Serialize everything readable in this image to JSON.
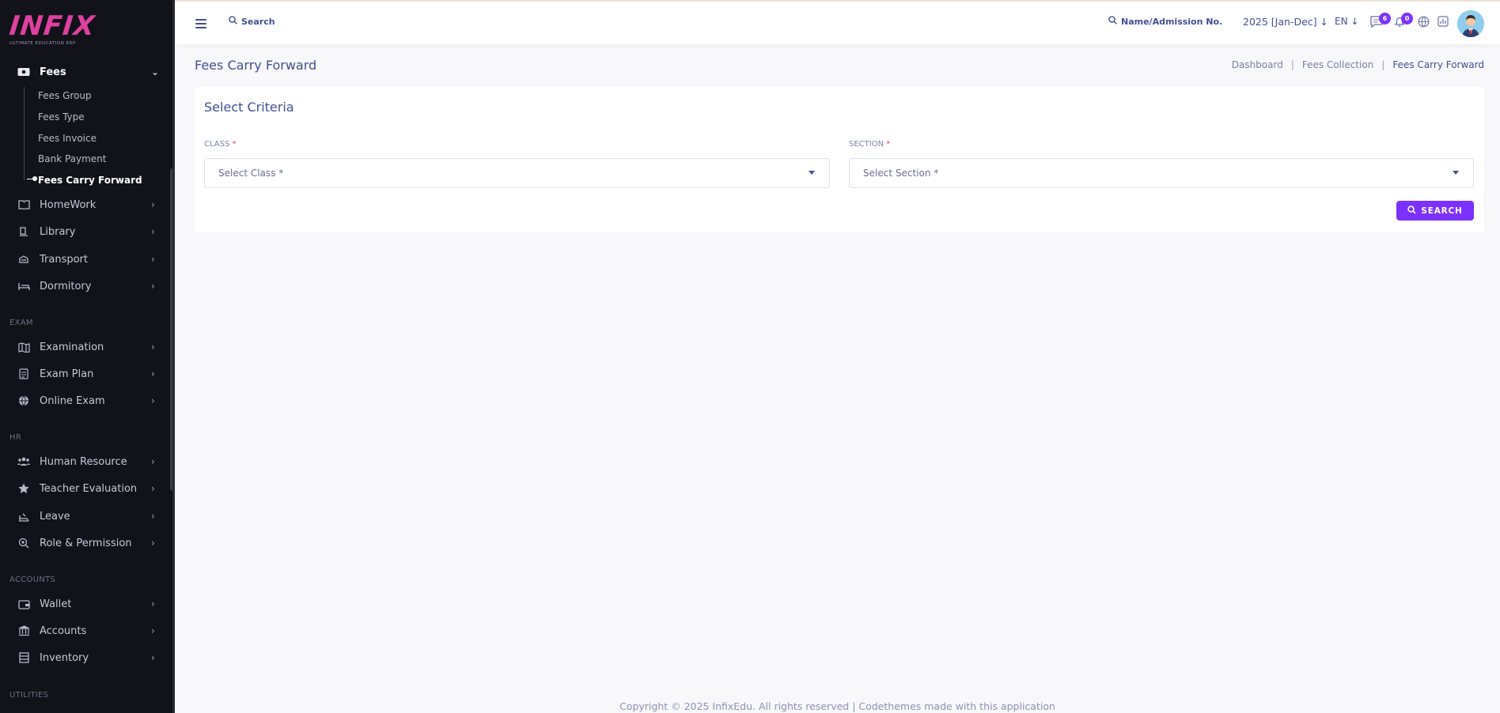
{
  "brand": {
    "logo": "INFIX",
    "tagline": "ULTIMATE EDUCATION ERP"
  },
  "sidebar": {
    "fees": {
      "label": "Fees",
      "icon": "money-icon"
    },
    "fees_sub": [
      "Fees Group",
      "Fees Type",
      "Fees Invoice",
      "Bank Payment",
      "Fees Carry Forward"
    ],
    "group1": [
      {
        "label": "HomeWork",
        "icon": "book-icon"
      },
      {
        "label": "Library",
        "icon": "library-icon"
      },
      {
        "label": "Transport",
        "icon": "bus-icon"
      },
      {
        "label": "Dormitory",
        "icon": "bed-icon"
      }
    ],
    "sections": {
      "exam": "EXAM",
      "hr": "HR",
      "accounts": "ACCOUNTS",
      "utilities": "UTILITIES"
    },
    "exam": [
      {
        "label": "Examination",
        "icon": "map-icon"
      },
      {
        "label": "Exam Plan",
        "icon": "clipboard-icon"
      },
      {
        "label": "Online Exam",
        "icon": "globe-icon"
      }
    ],
    "hr": [
      {
        "label": "Human Resource",
        "icon": "users-icon"
      },
      {
        "label": "Teacher Evaluation",
        "icon": "star-icon"
      },
      {
        "label": "Leave",
        "icon": "leave-icon"
      },
      {
        "label": "Role & Permission",
        "icon": "permission-icon"
      }
    ],
    "accounts": [
      {
        "label": "Wallet",
        "icon": "wallet-icon"
      },
      {
        "label": "Accounts",
        "icon": "bank-icon"
      },
      {
        "label": "Inventory",
        "icon": "inventory-icon"
      }
    ]
  },
  "header": {
    "search_label": "Search",
    "name_search": "Name/Admission No.",
    "year": "2025 [Jan-Dec]",
    "language": "EN",
    "messages_count": "6",
    "notifications_count": "0"
  },
  "page": {
    "title": "Fees Carry Forward",
    "breadcrumb": [
      "Dashboard",
      "Fees Collection",
      "Fees Carry Forward"
    ]
  },
  "criteria": {
    "title": "Select Criteria",
    "class_label": "CLASS",
    "class_placeholder": "Select Class *",
    "section_label": "SECTION",
    "section_placeholder": "Select Section *",
    "required_mark": "*",
    "search_button": "SEARCH"
  },
  "footer": {
    "text": "Copyright © 2025 InfixEdu. All rights reserved | Codethemes made with this application"
  },
  "colors": {
    "accent": "#7c32ff",
    "text": "#415094",
    "sidebar_bg": "#12121a"
  }
}
